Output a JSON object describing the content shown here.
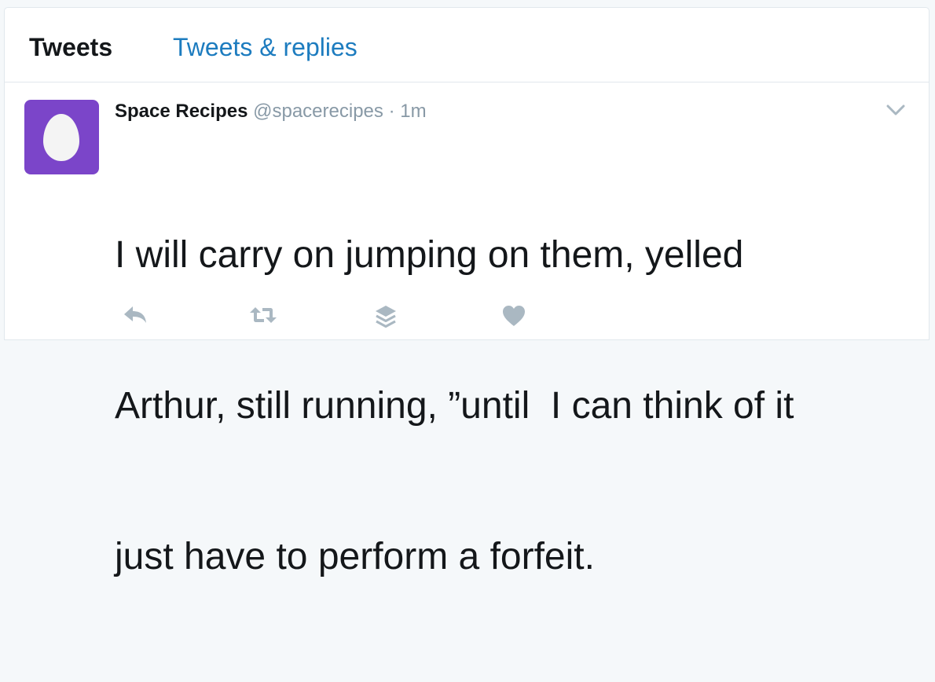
{
  "tabs": {
    "active_label": "Tweets",
    "inactive_label": "Tweets & replies"
  },
  "tweet": {
    "fullname": "Space Recipes",
    "username": "@spacerecipes",
    "separator": "·",
    "time": "1m",
    "text_lines": [
      "I will carry on jumping on them, yelled",
      "Arthur, still running, ”until  I can think of it",
      "just have to perform a forfeit."
    ]
  },
  "icons": {
    "avatar": "egg-avatar-icon",
    "chevron": "chevron-down-icon",
    "reply": "reply-icon",
    "retweet": "retweet-icon",
    "stack": "layers-icon",
    "like": "heart-icon"
  },
  "colors": {
    "avatar_bg": "#7b45c9",
    "link": "#1d7cbf",
    "action_icon": "#aab8c2"
  }
}
